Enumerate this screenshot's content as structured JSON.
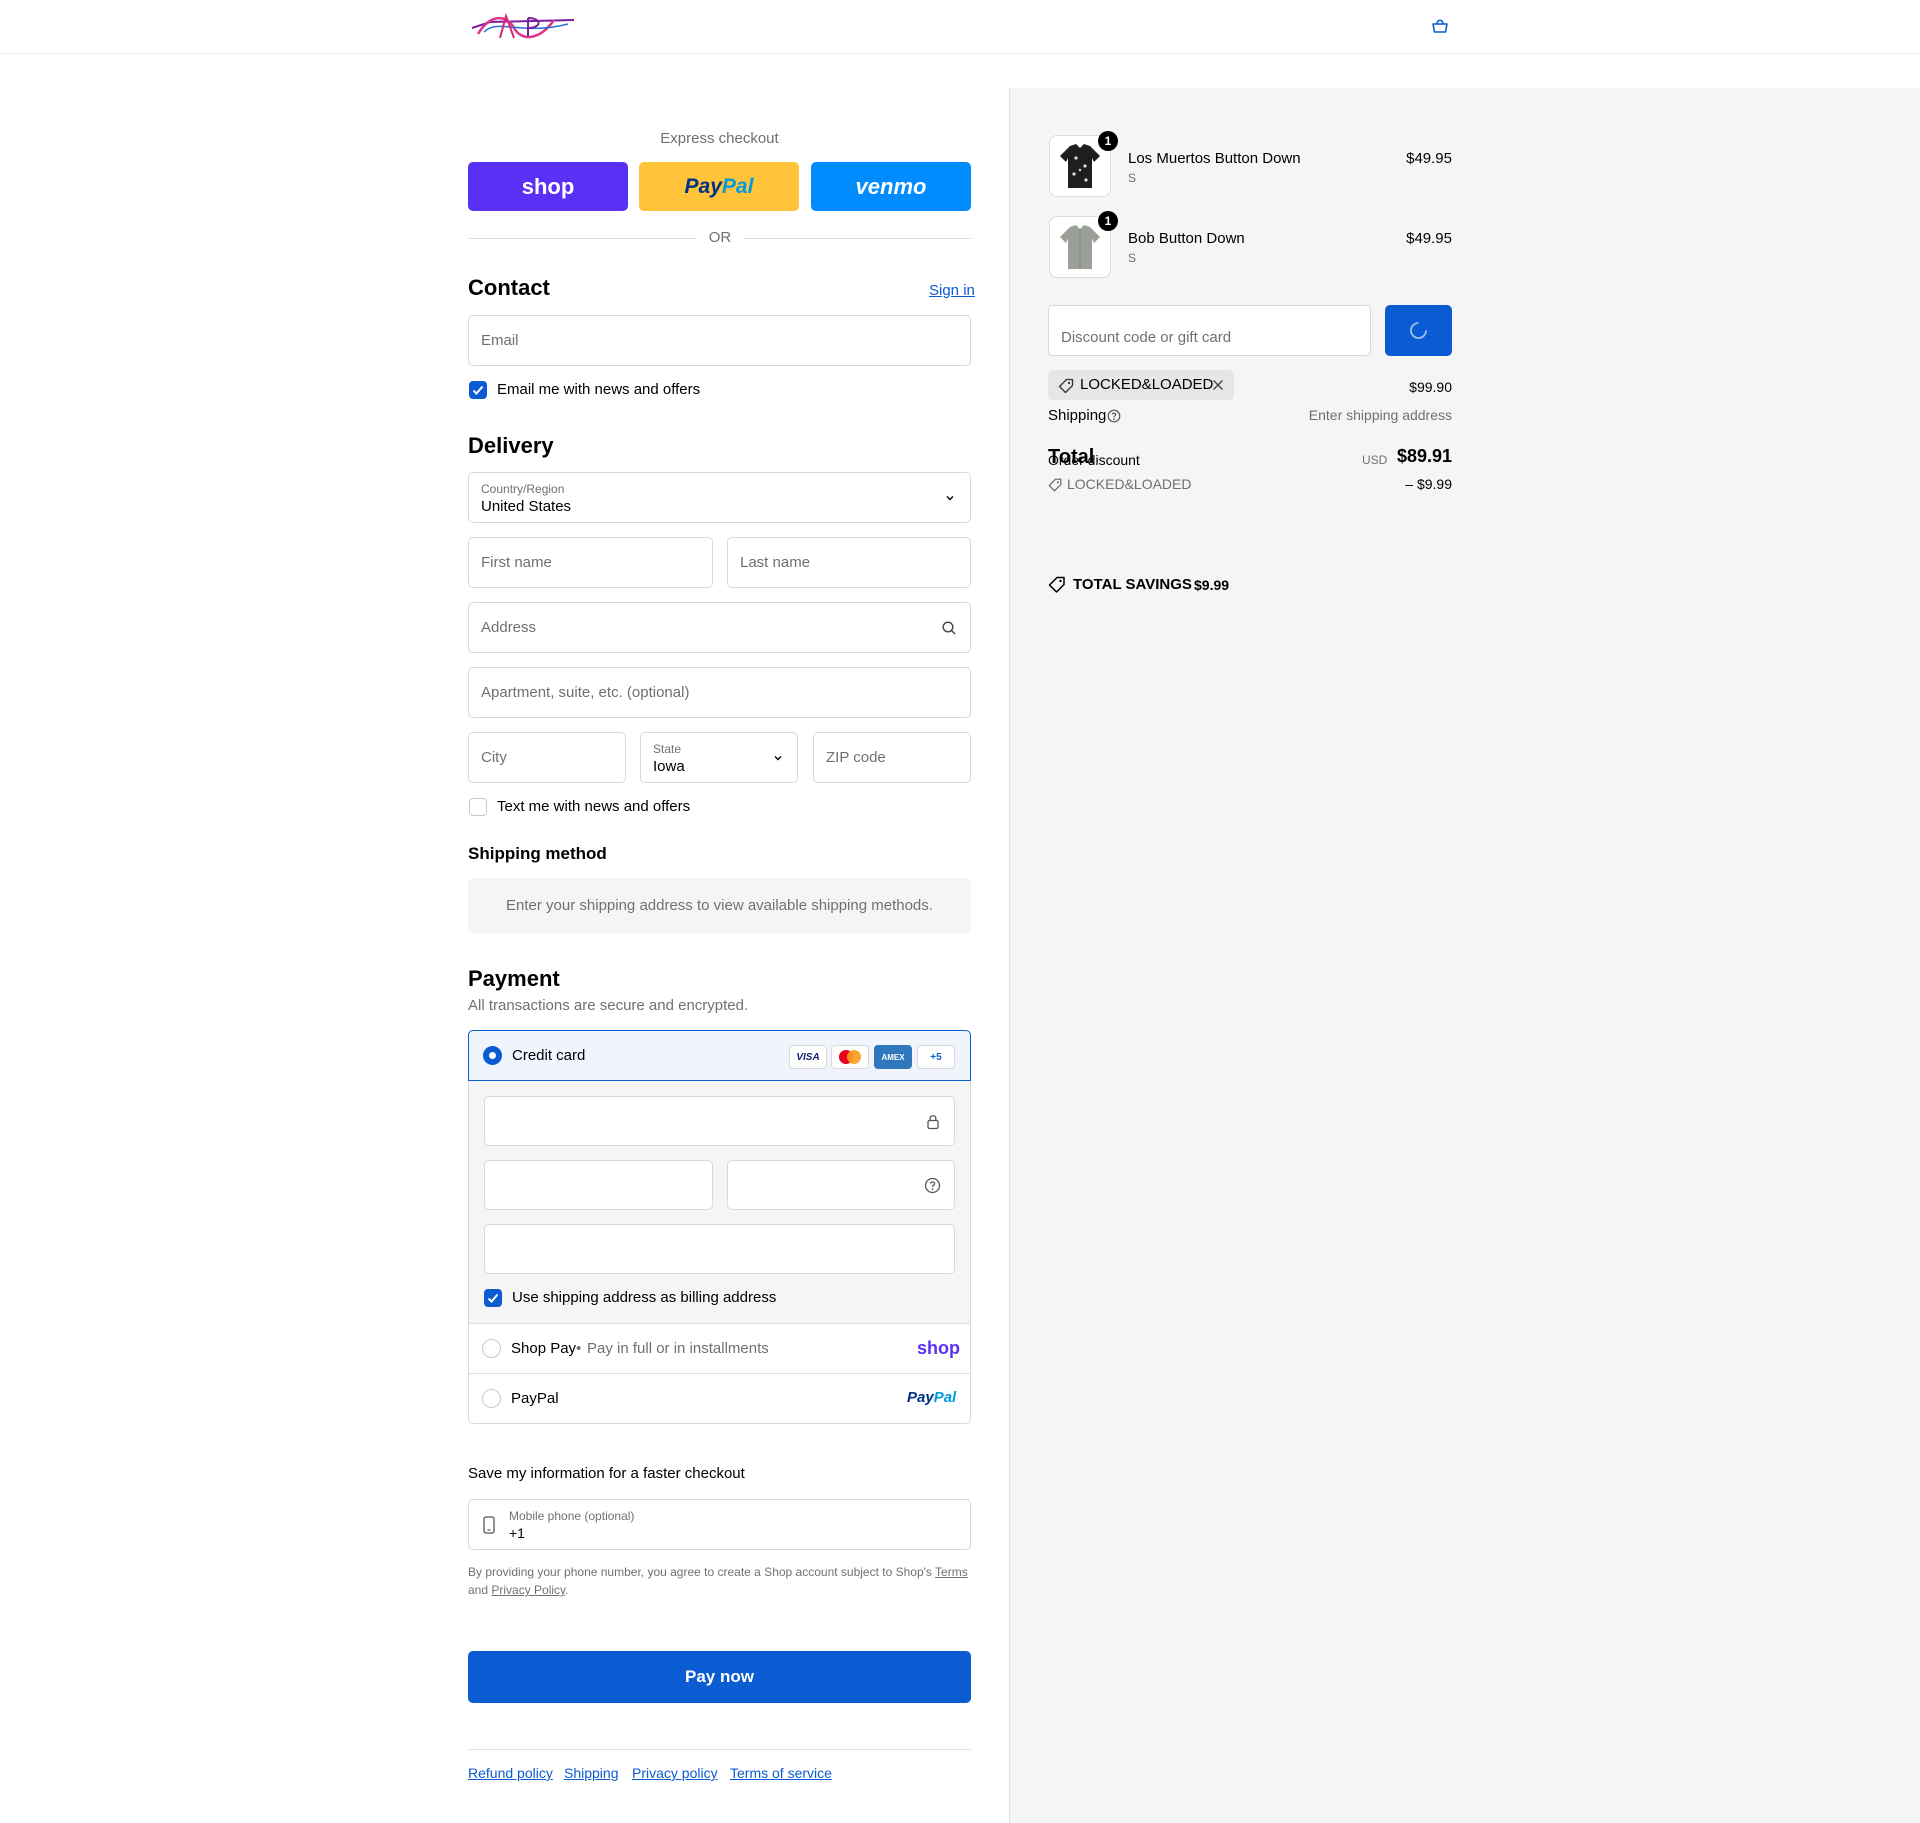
{
  "express": {
    "title": "Express checkout",
    "shop_label": "shop",
    "paypal_label_a": "Pay",
    "paypal_label_b": "Pal",
    "venmo_label": "venmo",
    "or_label": "OR"
  },
  "contact": {
    "heading": "Contact",
    "sign_in": "Sign in",
    "email_placeholder": "Email",
    "news_label": "Email me with news and offers"
  },
  "delivery": {
    "heading": "Delivery",
    "country_label": "Country/Region",
    "country_value": "United States",
    "first_name_placeholder": "First name",
    "last_name_placeholder": "Last name",
    "address_placeholder": "Address",
    "apartment_placeholder": "Apartment, suite, etc. (optional)",
    "city_placeholder": "City",
    "state_label": "State",
    "state_value": "Iowa",
    "zip_placeholder": "ZIP code",
    "text_label": "Text me with news and offers"
  },
  "shipping_method": {
    "heading": "Shipping method",
    "message": "Enter your shipping address to view available shipping methods."
  },
  "payment": {
    "heading": "Payment",
    "subtitle": "All transactions are secure and encrypted.",
    "credit_card_label": "Credit card",
    "card_brands": [
      "VISA",
      "AMEX",
      "+5"
    ],
    "billing_label": "Use shipping address as billing address",
    "shop_pay_label": "Shop Pay",
    "shop_pay_sub": "Pay in full or in installments",
    "shop_pay_logo": "shop",
    "paypal_label": "PayPal",
    "paypal_logo_a": "Pay",
    "paypal_logo_b": "Pal"
  },
  "save_info": {
    "heading": "Save my information for a faster checkout",
    "phone_label": "Mobile phone (optional)",
    "phone_value": "+1",
    "legal_prefix": "By providing your phone number, you agree to create a Shop account subject to Shop's",
    "terms": "Terms",
    "and": "and",
    "privacy": "Privacy Policy",
    "period": "."
  },
  "pay_now": "Pay now",
  "footer_links": [
    "Refund policy",
    "Shipping",
    "Privacy policy",
    "Terms of service"
  ],
  "cart": {
    "items": [
      {
        "name": "Los Muertos Button Down",
        "variant": "S",
        "price": "$49.95",
        "qty": "1"
      },
      {
        "name": "Bob Button Down",
        "variant": "S",
        "price": "$49.95",
        "qty": "1"
      }
    ],
    "discount_placeholder": "Discount code or gift card",
    "applied_code": "LOCKED&LOADED",
    "subtotal_value": "$99.90",
    "shipping_label": "Shipping",
    "shipping_value": "Enter shipping address",
    "total_label": "Total",
    "order_discount_label": "Order discount",
    "currency": "USD",
    "total_value": "$89.91",
    "discount_code_line": "LOCKED&LOADED",
    "discount_amount": "– $9.99",
    "total_savings_label": "TOTAL SAVINGS",
    "total_savings_value": "$9.99"
  },
  "colors": {
    "accent": "#0b5bd3",
    "shop_purple": "#5a31f4",
    "paypal_yellow": "#ffc439",
    "venmo_blue": "#008cff",
    "summary_bg": "#f5f5f5"
  },
  "icons": [
    "logo-icon",
    "cart-icon",
    "search-icon",
    "chevron-down-icon",
    "lock-icon",
    "help-icon",
    "tag-icon",
    "close-icon",
    "phone-icon",
    "spinner-icon"
  ]
}
